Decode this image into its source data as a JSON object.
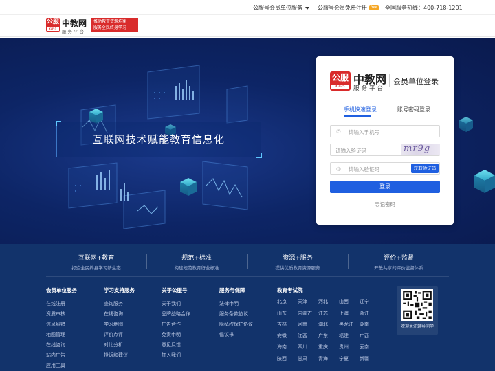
{
  "topbar": {
    "unit_service": "公服号会员单位服务",
    "free_register": "公服号会员免费注册",
    "free_badge": "free",
    "hotline": "全国服务热线：400-718-1201"
  },
  "header": {
    "logo_mark": "公服",
    "logo_mark_sub": "GF-5",
    "logo_name": "中教网",
    "logo_sub": "服务平台",
    "slogan_line1": "推动教育资源均衡",
    "slogan_line2": "服务全民终身学习"
  },
  "hero": {
    "tagline": "互联网技术赋能教育信息化"
  },
  "login": {
    "logo_mark": "公服",
    "logo_mark_sub": "GF-5",
    "logo_name": "中教网",
    "logo_sub": "服务平台",
    "title": "会员单位登录",
    "tabs": [
      "手机快速登录",
      "账号密码登录"
    ],
    "phone_placeholder": "请输入手机号",
    "captcha_placeholder": "请输入验证码",
    "captcha_text": "mr9g",
    "sms_placeholder": "请输入验证码",
    "sms_button": "获取验证码",
    "submit": "登录",
    "forgot": "忘记密码"
  },
  "footer": {
    "pillars": [
      {
        "title": "互联网+教育",
        "sub": "打造全民终身学习新生态"
      },
      {
        "title": "规范+标准",
        "sub": "构建规范教育行业标准"
      },
      {
        "title": "资源+服务",
        "sub": "提供优质教育资源服务"
      },
      {
        "title": "评价+监督",
        "sub": "开放共享的评价监督体系"
      }
    ],
    "columns": [
      {
        "heading": "会员单位服务",
        "links": [
          "在线注册",
          "资质审核",
          "信息纠错",
          "地图管理",
          "在线咨询",
          "站内广告",
          "应用工具"
        ]
      },
      {
        "heading": "学习支持服务",
        "links": [
          "查询服务",
          "在线咨询",
          "学习地图",
          "评价点评",
          "对比分析",
          "投诉和建议"
        ]
      },
      {
        "heading": "关于公服号",
        "links": [
          "关于我们",
          "品牌战略合作",
          "广告合作",
          "免责申明",
          "意见反馈",
          "加入我们"
        ]
      },
      {
        "heading": "服务与保障",
        "links": [
          "法律申明",
          "服务条款协议",
          "隐私权保护协议",
          "倡议书"
        ]
      }
    ],
    "provinces_heading": "教育考试院",
    "provinces": [
      "北京",
      "天津",
      "河北",
      "山西",
      "辽宁",
      "山东",
      "内蒙古",
      "江苏",
      "上海",
      "浙江",
      "吉林",
      "河南",
      "湖北",
      "黑龙江",
      "湖南",
      "安徽",
      "江西",
      "广东",
      "福建",
      "广西",
      "海南",
      "四川",
      "重庆",
      "贵州",
      "云南",
      "陕西",
      "甘肃",
      "青海",
      "宁夏",
      "新疆"
    ],
    "qr_caption": "欢迎关注辅导同学"
  },
  "colors": {
    "brand_red": "#d92b2b",
    "primary_blue": "#1f5fe0",
    "hero_bg": "#0d2566",
    "footer_bg": "#12336b"
  }
}
